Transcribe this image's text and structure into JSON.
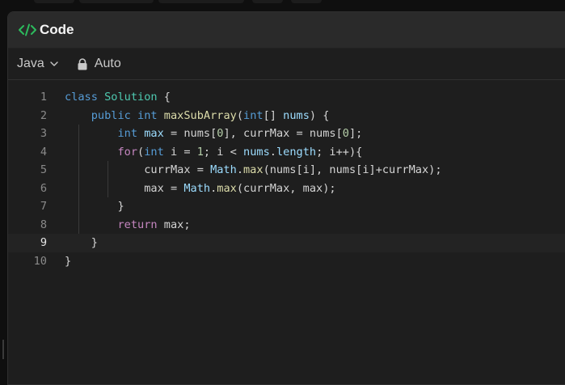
{
  "header": {
    "title": "Code",
    "icon": "code-brackets-icon",
    "accent": "#2cbb5d"
  },
  "toolbar": {
    "language": "Java",
    "mode": "Auto"
  },
  "editor": {
    "active_line": 9,
    "lines": [
      {
        "n": "1"
      },
      {
        "n": "2"
      },
      {
        "n": "3"
      },
      {
        "n": "4"
      },
      {
        "n": "5"
      },
      {
        "n": "6"
      },
      {
        "n": "7"
      },
      {
        "n": "8"
      },
      {
        "n": "9"
      },
      {
        "n": "10"
      }
    ],
    "tokens": {
      "l1": [
        "class",
        " ",
        "Solution",
        " {"
      ],
      "l2": [
        "public",
        " ",
        "int",
        " ",
        "maxSubArray",
        "(",
        "int",
        "[] ",
        "nums",
        ") {"
      ],
      "l3": [
        "int",
        " ",
        "max",
        " = nums[",
        "0",
        "], currMax = nums[",
        "0",
        "];"
      ],
      "l4": [
        "for",
        "(",
        "int",
        " i = ",
        "1",
        "; i < ",
        "nums",
        ".",
        "length",
        "; i++){"
      ],
      "l5": [
        "currMax = ",
        "Math",
        ".",
        "max",
        "(nums[i], nums[i]+currMax);"
      ],
      "l6": [
        "max = ",
        "Math",
        ".",
        "max",
        "(currMax, max);"
      ],
      "l7": [
        "}"
      ],
      "l8": [
        "return",
        " max;"
      ],
      "l9": [
        "}"
      ],
      "l10": [
        "}"
      ]
    }
  }
}
